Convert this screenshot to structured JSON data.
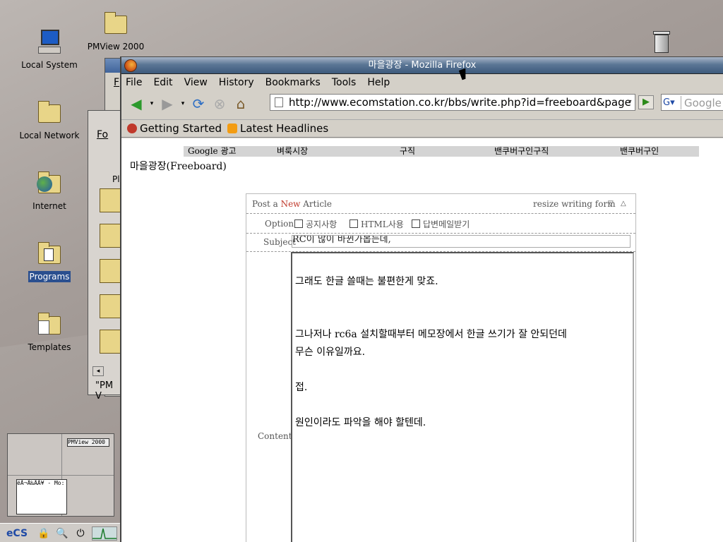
{
  "desktop": {
    "icons": [
      {
        "label": "Local System"
      },
      {
        "label": "PMView 2000"
      },
      {
        "label": "Local Network"
      },
      {
        "label": "Internet"
      },
      {
        "label": "Programs"
      },
      {
        "label": "Templates"
      }
    ],
    "behind_window_text": "\"PM V",
    "behind_menu_f": "F",
    "behind_menu_fo": "Fo",
    "behind_pm": "Pl"
  },
  "pager": {
    "top_right_label": "PMView 2000",
    "bottom_left_label": "ëÃ¬Ã‰Ã­Ã¥ - Mo:"
  },
  "window": {
    "title": "마을광장 - Mozilla Firefox"
  },
  "menubar": {
    "items": [
      "File",
      "Edit",
      "View",
      "History",
      "Bookmarks",
      "Tools",
      "Help"
    ]
  },
  "navbar": {
    "url": "http://www.ecomstation.co.kr/bbs/write.php?id=freeboard&page",
    "search_placeholder": "Google",
    "search_engine": "G"
  },
  "bookmarks": {
    "items": [
      "Getting Started",
      "Latest Headlines"
    ]
  },
  "page": {
    "google_nav": [
      "Google 광고",
      "벼룩시장",
      "구직",
      "밴쿠버구인구직",
      "밴쿠버구인"
    ],
    "board_title": "마을광장(Freeboard)",
    "form": {
      "header_prefix": "Post a ",
      "header_new": "New",
      "header_suffix": " Article",
      "resize_label": "resize writing form",
      "option_label": "Option",
      "options": [
        "공지사항",
        "HTML사용",
        "답변메일받기"
      ],
      "subject_label": "Subject",
      "subject_value": "RC이 많이 바뀐가봅는데,",
      "contents_label": "Contents",
      "contents_lines": [
        "그래도 한글 쓸때는 불편한게 맞죠.",
        "",
        "",
        "그나저나 rc6a 설치할때부터 메모장에서 한글 쓰기가 잘 안되던데",
        "무슨 이유일까요.",
        "",
        "접.",
        "",
        "원인이라도 파악을 해야 할텐데."
      ]
    }
  }
}
